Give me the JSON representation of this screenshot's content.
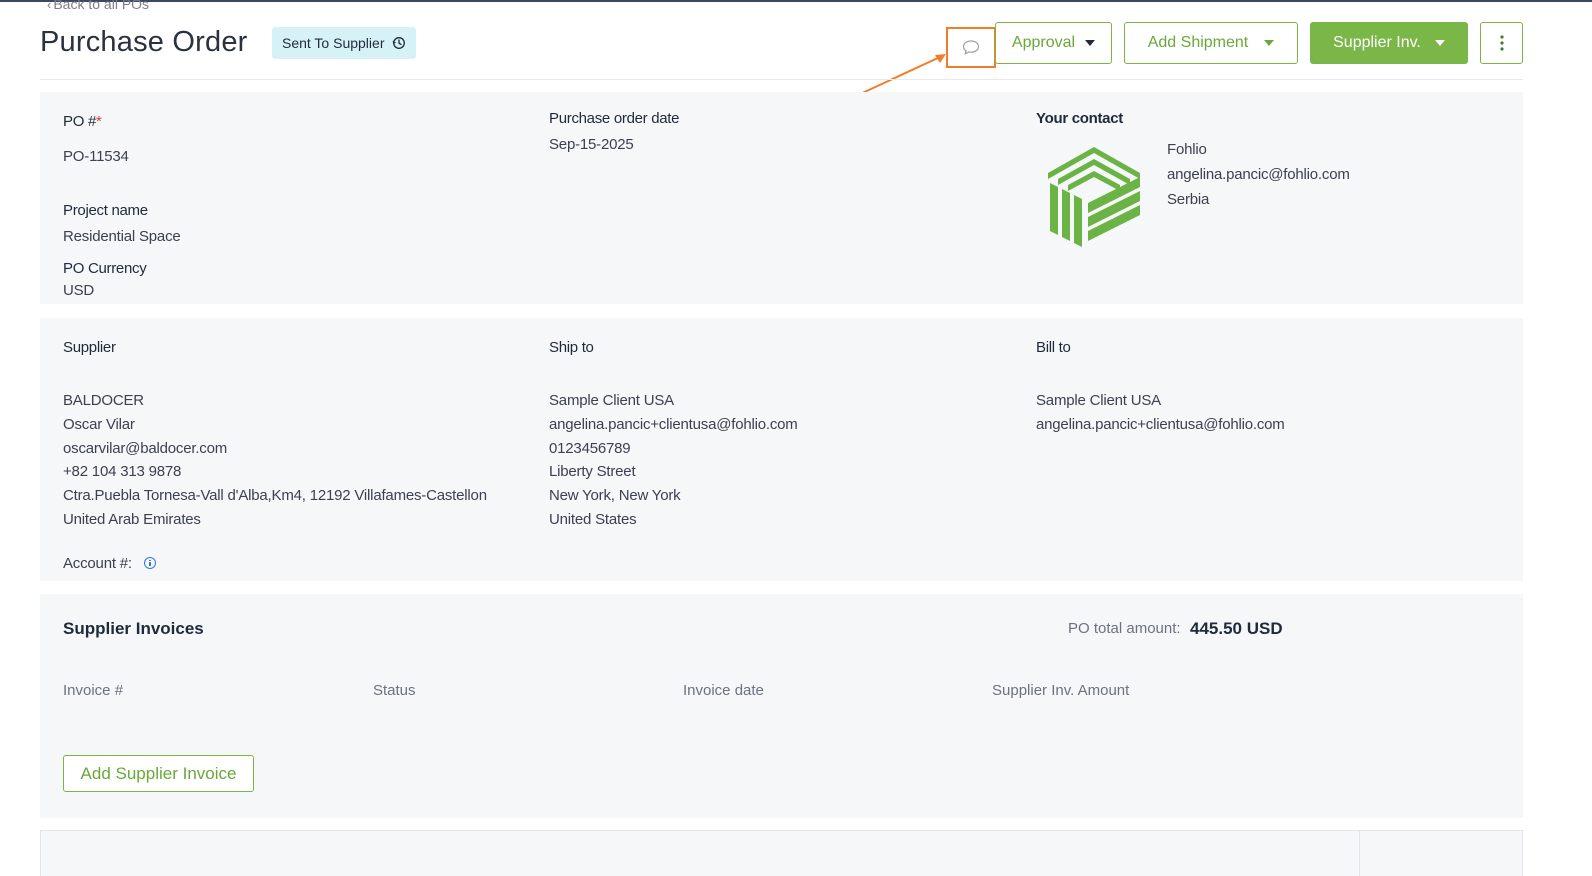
{
  "header": {
    "back_link": "Back to all POs",
    "title": "Purchase Order",
    "status": "Sent To Supplier",
    "buttons": {
      "approval": "Approval",
      "add_shipment": "Add Shipment",
      "supplier_inv": "Supplier Inv."
    }
  },
  "po_info": {
    "po_number_label": "PO #",
    "po_number_required": "*",
    "po_number": "PO-11534",
    "project_name_label": "Project name",
    "project_name": "Residential Space",
    "currency_label": "PO Currency",
    "currency": "USD",
    "date_label": "Purchase order date",
    "date": "Sep-15-2025",
    "contact_label": "Your contact",
    "contact": {
      "company": "Fohlio",
      "email": "angelina.pancic@fohlio.com",
      "country": "Serbia"
    }
  },
  "parties": {
    "supplier_label": "Supplier",
    "supplier_lines": [
      "BALDOCER",
      "Oscar Vilar",
      "oscarvilar@baldocer.com",
      "+82 104 313 9878",
      "Ctra.Puebla Tornesa-Vall d'Alba,Km4, 12192 Villafames-Castellon",
      "United Arab Emirates"
    ],
    "account_label": "Account #:",
    "ship_to_label": "Ship to",
    "ship_to_lines": [
      "Sample Client USA",
      "angelina.pancic+clientusa@fohlio.com",
      "0123456789",
      "Liberty Street",
      "New York, New York",
      "United States"
    ],
    "bill_to_label": "Bill to",
    "bill_to_lines": [
      "Sample Client USA",
      "angelina.pancic+clientusa@fohlio.com"
    ]
  },
  "invoices": {
    "title": "Supplier Invoices",
    "total_label": "PO total amount:",
    "total_value": "445.50 USD",
    "columns": [
      "Invoice #",
      "Status",
      "Invoice date",
      "Supplier Inv. Amount"
    ],
    "add_button": "Add Supplier Invoice"
  },
  "colors": {
    "accent_green": "#7ab648",
    "highlight_orange": "#f17c2b",
    "badge_bg": "#d6f2f6"
  }
}
